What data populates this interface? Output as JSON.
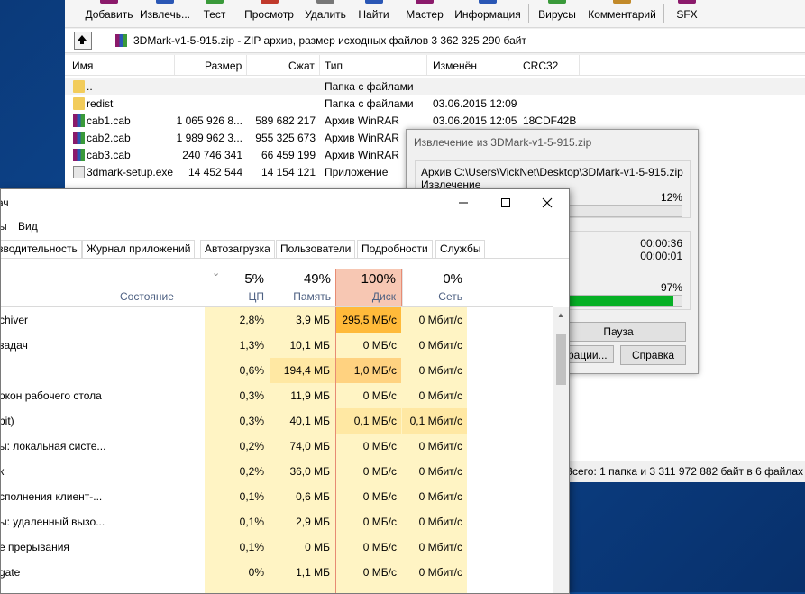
{
  "colors": {
    "accent": "#0078d7",
    "disk_header": "#f7c7b3",
    "disk_border": "#e78c74",
    "cpu_bg": "#fff4c4",
    "heat_low": "#fff4c4",
    "heat_mid": "#ffe8a3",
    "heat_high": "#ffd280",
    "heat_max": "#ffba3a",
    "progress": "#06b025"
  },
  "winrar": {
    "toolbar": [
      {
        "label": "Добавить",
        "icon": "add-archive-icon"
      },
      {
        "label": "Извлечь...",
        "icon": "extract-icon"
      },
      {
        "label": "Тест",
        "icon": "test-icon"
      },
      {
        "label": "Просмотр",
        "icon": "view-icon"
      },
      {
        "label": "Удалить",
        "icon": "delete-icon"
      },
      {
        "label": "Найти",
        "icon": "find-icon"
      },
      {
        "label": "Мастер",
        "icon": "wizard-icon"
      },
      {
        "label": "Информация",
        "icon": "info-icon"
      },
      {
        "label": "Вирусы",
        "icon": "virus-scan-icon"
      },
      {
        "label": "Комментарий",
        "icon": "comment-icon"
      },
      {
        "label": "SFX",
        "icon": "sfx-icon"
      }
    ],
    "path": "3DMark-v1-5-915.zip - ZIP архив, размер исходных файлов 3 362 325 290 байт",
    "columns": {
      "name": "Имя",
      "size": "Размер",
      "packed": "Сжат",
      "type": "Тип",
      "modified": "Изменён",
      "crc": "CRC32"
    },
    "rows": [
      {
        "name": "..",
        "size": "",
        "packed": "",
        "type": "Папка с файлами",
        "modified": "",
        "crc": "",
        "icon": "folder"
      },
      {
        "name": "redist",
        "size": "",
        "packed": "",
        "type": "Папка с файлами",
        "modified": "03.06.2015 12:09",
        "crc": "",
        "icon": "folder"
      },
      {
        "name": "cab1.cab",
        "size": "1 065 926 8...",
        "packed": "589 682 217",
        "type": "Архив WinRAR",
        "modified": "03.06.2015 12:05",
        "crc": "18CDF42B",
        "icon": "rar"
      },
      {
        "name": "cab2.cab",
        "size": "1 989 962 3...",
        "packed": "955 325 673",
        "type": "Архив WinRAR",
        "modified": "",
        "crc": "",
        "icon": "rar"
      },
      {
        "name": "cab3.cab",
        "size": "240 746 341",
        "packed": "66 459 199",
        "type": "Архив WinRAR",
        "modified": "",
        "crc": "",
        "icon": "rar"
      },
      {
        "name": "3dmark-setup.exe",
        "size": "14 452 544",
        "packed": "14 154 121",
        "type": "Приложение",
        "modified": "",
        "crc": "",
        "icon": "exe"
      }
    ],
    "status": "Всего: 1 папка и 3 311 972 882 байт в 6 файлах"
  },
  "extract": {
    "title": "Извлечение из 3DMark-v1-5-915.zip",
    "archive": "Архив C:\\Users\\VickNet\\Desktop\\3DMark-v1-5-915.zip",
    "action": "Извлечение",
    "file_percent": "12%",
    "file_progress": 12,
    "elapsed": "00:00:36",
    "remaining": "00:00:01",
    "total_percent": "97%",
    "total_progress": 97,
    "pause_label": "Пауза",
    "ops_label": "рации...",
    "help_label": "Справка"
  },
  "taskmgr": {
    "title": "ач",
    "menu": [
      "ы",
      "Вид"
    ],
    "tabs": [
      "зводительность",
      "Журнал приложений",
      "Автозагрузка",
      "Пользователи",
      "Подробности",
      "Службы"
    ],
    "header": {
      "state": "Состояние",
      "cpu_pct": "5%",
      "cpu_label": "ЦП",
      "mem_pct": "49%",
      "mem_label": "Память",
      "disk_pct": "100%",
      "disk_label": "Диск",
      "net_pct": "0%",
      "net_label": "Сеть"
    },
    "rows": [
      {
        "name": "chiver",
        "cpu": "2,8%",
        "mem": "3,9 МБ",
        "disk": "295,5 МБ/с",
        "net": "0 Мбит/с",
        "heat": "max"
      },
      {
        "name": "задач",
        "cpu": "1,3%",
        "mem": "10,1 МБ",
        "disk": "0 МБ/с",
        "net": "0 Мбит/с",
        "heat": "low"
      },
      {
        "name": "",
        "cpu": "0,6%",
        "mem": "194,4 МБ",
        "disk": "1,0 МБ/с",
        "net": "0 Мбит/с",
        "heat": "high"
      },
      {
        "name": "окон рабочего стола",
        "cpu": "0,3%",
        "mem": "11,9 МБ",
        "disk": "0 МБ/с",
        "net": "0 Мбит/с",
        "heat": "low"
      },
      {
        "name": "bit)",
        "cpu": "0,3%",
        "mem": "40,1 МБ",
        "disk": "0,1 МБ/с",
        "net": "0,1 Мбит/с",
        "heat": "mid"
      },
      {
        "name": "ы: локальная систе...",
        "cpu": "0,2%",
        "mem": "74,0 МБ",
        "disk": "0 МБ/с",
        "net": "0 Мбит/с",
        "heat": "low"
      },
      {
        "name": "к",
        "cpu": "0,2%",
        "mem": "36,0 МБ",
        "disk": "0 МБ/с",
        "net": "0 Мбит/с",
        "heat": "low"
      },
      {
        "name": "сполнения клиент-...",
        "cpu": "0,1%",
        "mem": "0,6 МБ",
        "disk": "0 МБ/с",
        "net": "0 Мбит/с",
        "heat": "low"
      },
      {
        "name": "ы: удаленный вызо...",
        "cpu": "0,1%",
        "mem": "2,9 МБ",
        "disk": "0 МБ/с",
        "net": "0 Мбит/с",
        "heat": "low"
      },
      {
        "name": "е прерывания",
        "cpu": "0,1%",
        "mem": "0 МБ",
        "disk": "0 МБ/с",
        "net": "0 Мбит/с",
        "heat": "low"
      },
      {
        "name": "gate",
        "cpu": "0%",
        "mem": "1,1 МБ",
        "disk": "0 МБ/с",
        "net": "0 Мбит/с",
        "heat": "low"
      }
    ]
  }
}
